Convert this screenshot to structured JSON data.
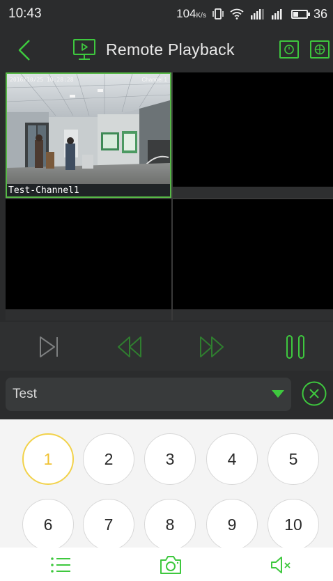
{
  "status_bar": {
    "time": "10:43",
    "speed": "104",
    "speed_unit": "K/s",
    "battery": "36"
  },
  "header": {
    "title": "Remote Playback"
  },
  "video": {
    "osd_time": "2016/10/25 10:28:28",
    "osd_channel": "Channel 1",
    "channel_label": "Test-Channel1"
  },
  "selector": {
    "value": "Test"
  },
  "keypad": {
    "keys": [
      "1",
      "2",
      "3",
      "4",
      "5",
      "6",
      "7",
      "8",
      "9",
      "10"
    ],
    "selected": "1"
  },
  "colors": {
    "accent": "#3ec83e",
    "selected_key": "#f2d24a"
  }
}
